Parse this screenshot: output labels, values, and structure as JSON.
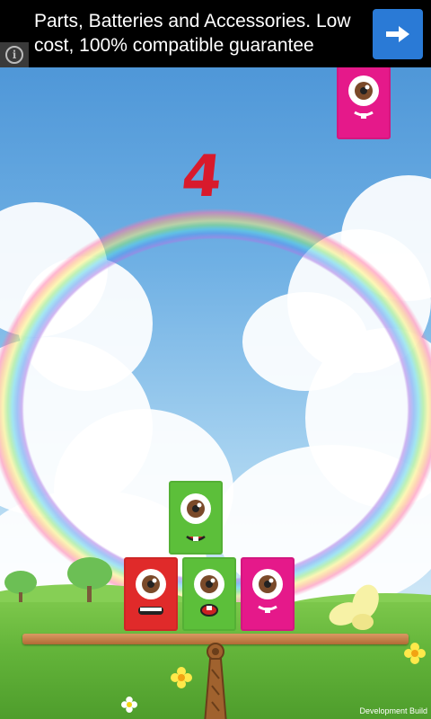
{
  "ad": {
    "text": "Parts, Batteries and Accessories. Low cost, 100% compatible guarantee",
    "info_icon": "info-icon",
    "arrow_icon": "arrow-right-icon",
    "info_glyph": "i"
  },
  "game": {
    "score": "4",
    "dev_label": "Development Build"
  },
  "colors": {
    "pink": "#e5198a",
    "green": "#5cbf3a",
    "red": "#e02a2a",
    "ad_button": "#2a7ad6",
    "score": "#d81a2c"
  }
}
